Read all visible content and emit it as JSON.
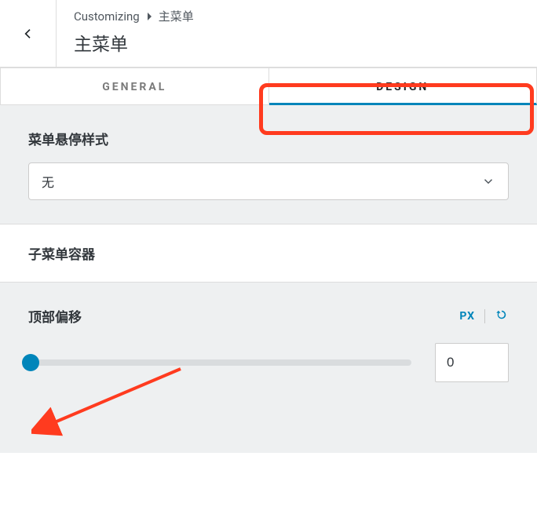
{
  "header": {
    "breadcrumb_root": "Customizing",
    "breadcrumb_current": "主菜单",
    "panel_title": "主菜单"
  },
  "tabs": {
    "general": "GENERAL",
    "design": "DESIGN",
    "active": "design"
  },
  "hover_style": {
    "label": "菜单悬停样式",
    "value": "无"
  },
  "submenu_container": {
    "label": "子菜单容器"
  },
  "top_offset": {
    "label": "顶部偏移",
    "unit": "PX",
    "value": "0"
  },
  "annotation": {
    "highlight_color": "#ff3b1f"
  }
}
